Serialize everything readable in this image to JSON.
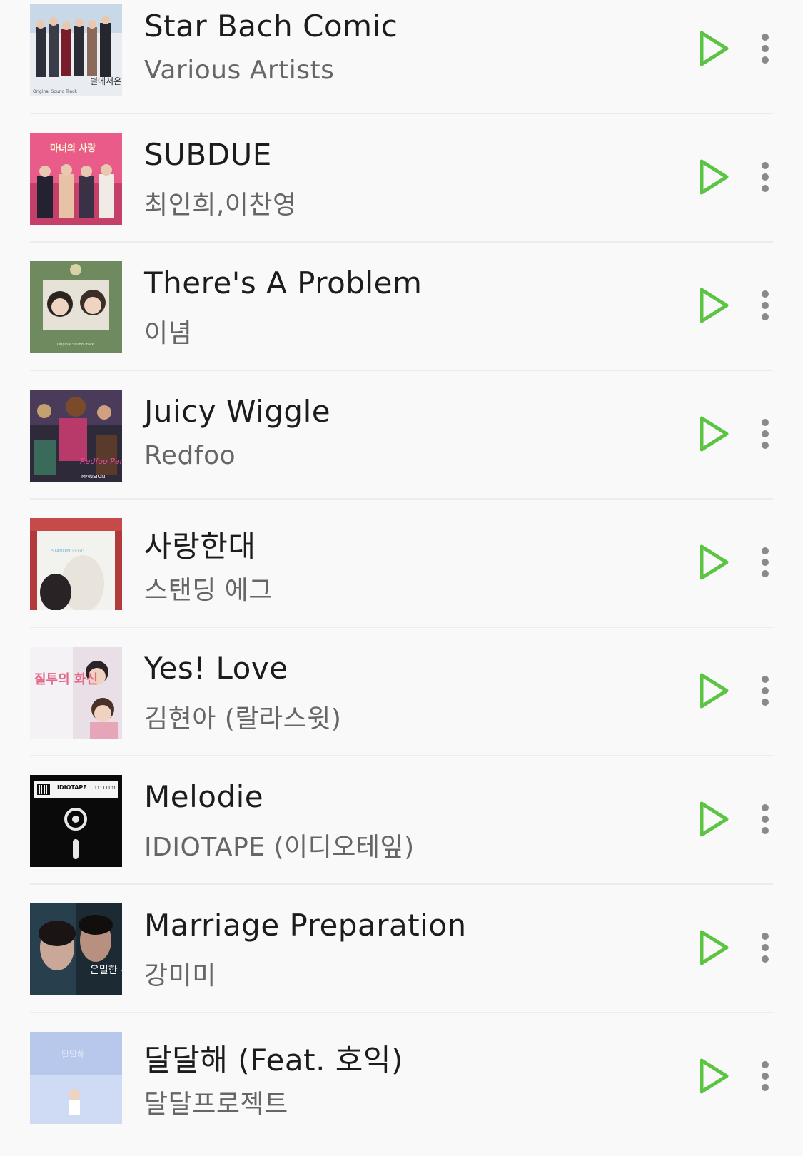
{
  "accent_color": "#5cc443",
  "songs": [
    {
      "title": "Star Bach Comic",
      "artist": "Various Artists",
      "cover_text": "별에서온 그대",
      "cover_sub": "Original Sound Track"
    },
    {
      "title": "SUBDUE",
      "artist": "최인희,이찬영",
      "cover_text": "마녀의 사랑"
    },
    {
      "title": "There's A Problem",
      "artist": "이념",
      "cover_text": "Original Sound Track"
    },
    {
      "title": "Juicy Wiggle",
      "artist": "Redfoo",
      "cover_text": "Redfoo Party Rock",
      "cover_sub": "MANSION"
    },
    {
      "title": "사랑한대",
      "artist": "스탠딩 에그",
      "cover_text": "STANDING EGG"
    },
    {
      "title": "Yes! Love",
      "artist": "김현아 (랄라스윗)",
      "cover_text": "질투의 화신"
    },
    {
      "title": "Melodie",
      "artist": "IDIOTAPE (이디오테잎)",
      "cover_text": "IDIOTAPE",
      "cover_sub": "11111101"
    },
    {
      "title": "Marriage Preparation",
      "artist": "강미미",
      "cover_text": "은밀한 유혹"
    },
    {
      "title": "달달해 (Feat. 호익)",
      "artist": "달달프로젝트",
      "cover_text": "달달해"
    }
  ],
  "icons": {
    "play": "play-icon",
    "more": "more-vertical-icon"
  }
}
